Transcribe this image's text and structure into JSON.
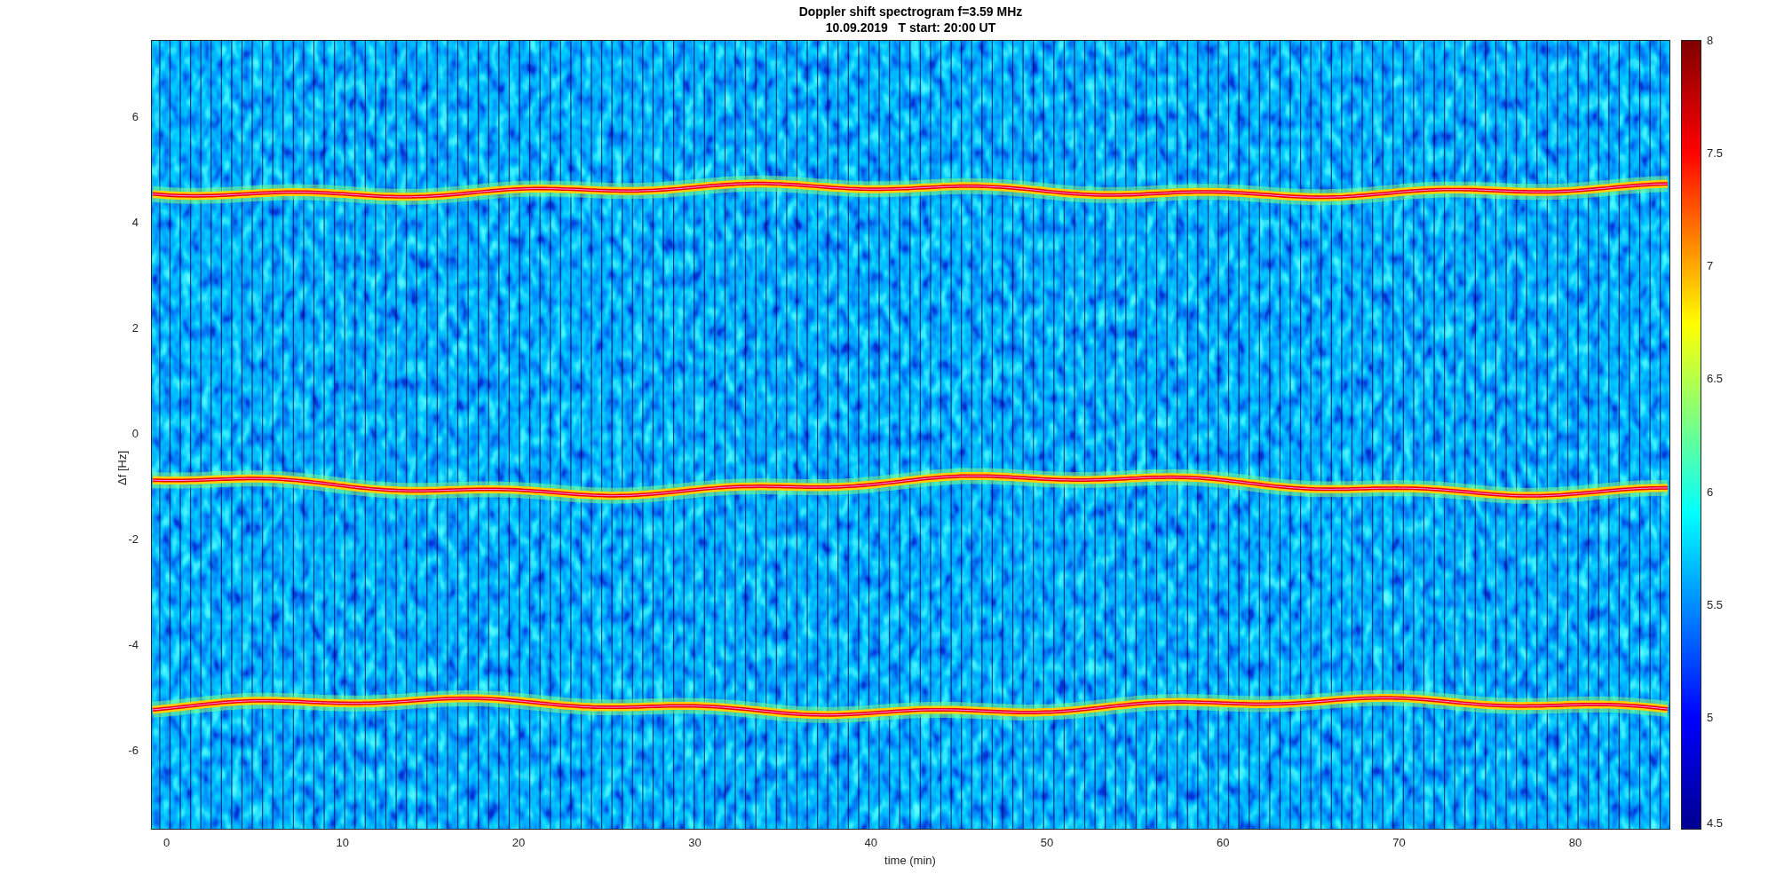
{
  "figure": {
    "title": "Doppler shift spectrogram f=3.59 MHz",
    "subtitle": "10.09.2019   T start: 20:00 UT"
  },
  "plot": {
    "y_axis": {
      "label": "Δf [Hz]",
      "ticks": [
        "6",
        "4",
        "2",
        "0",
        "-2",
        "-4",
        "-6"
      ]
    },
    "x_axis": {
      "label": "time (min)",
      "ticks": [
        "0",
        "10",
        "20",
        "30",
        "40",
        "50",
        "60",
        "70",
        "80"
      ]
    }
  },
  "colorbar": {
    "ticks": [
      "8",
      "7.5",
      "7",
      "6.5",
      "6",
      "5.5",
      "5",
      "4.5"
    ]
  }
}
